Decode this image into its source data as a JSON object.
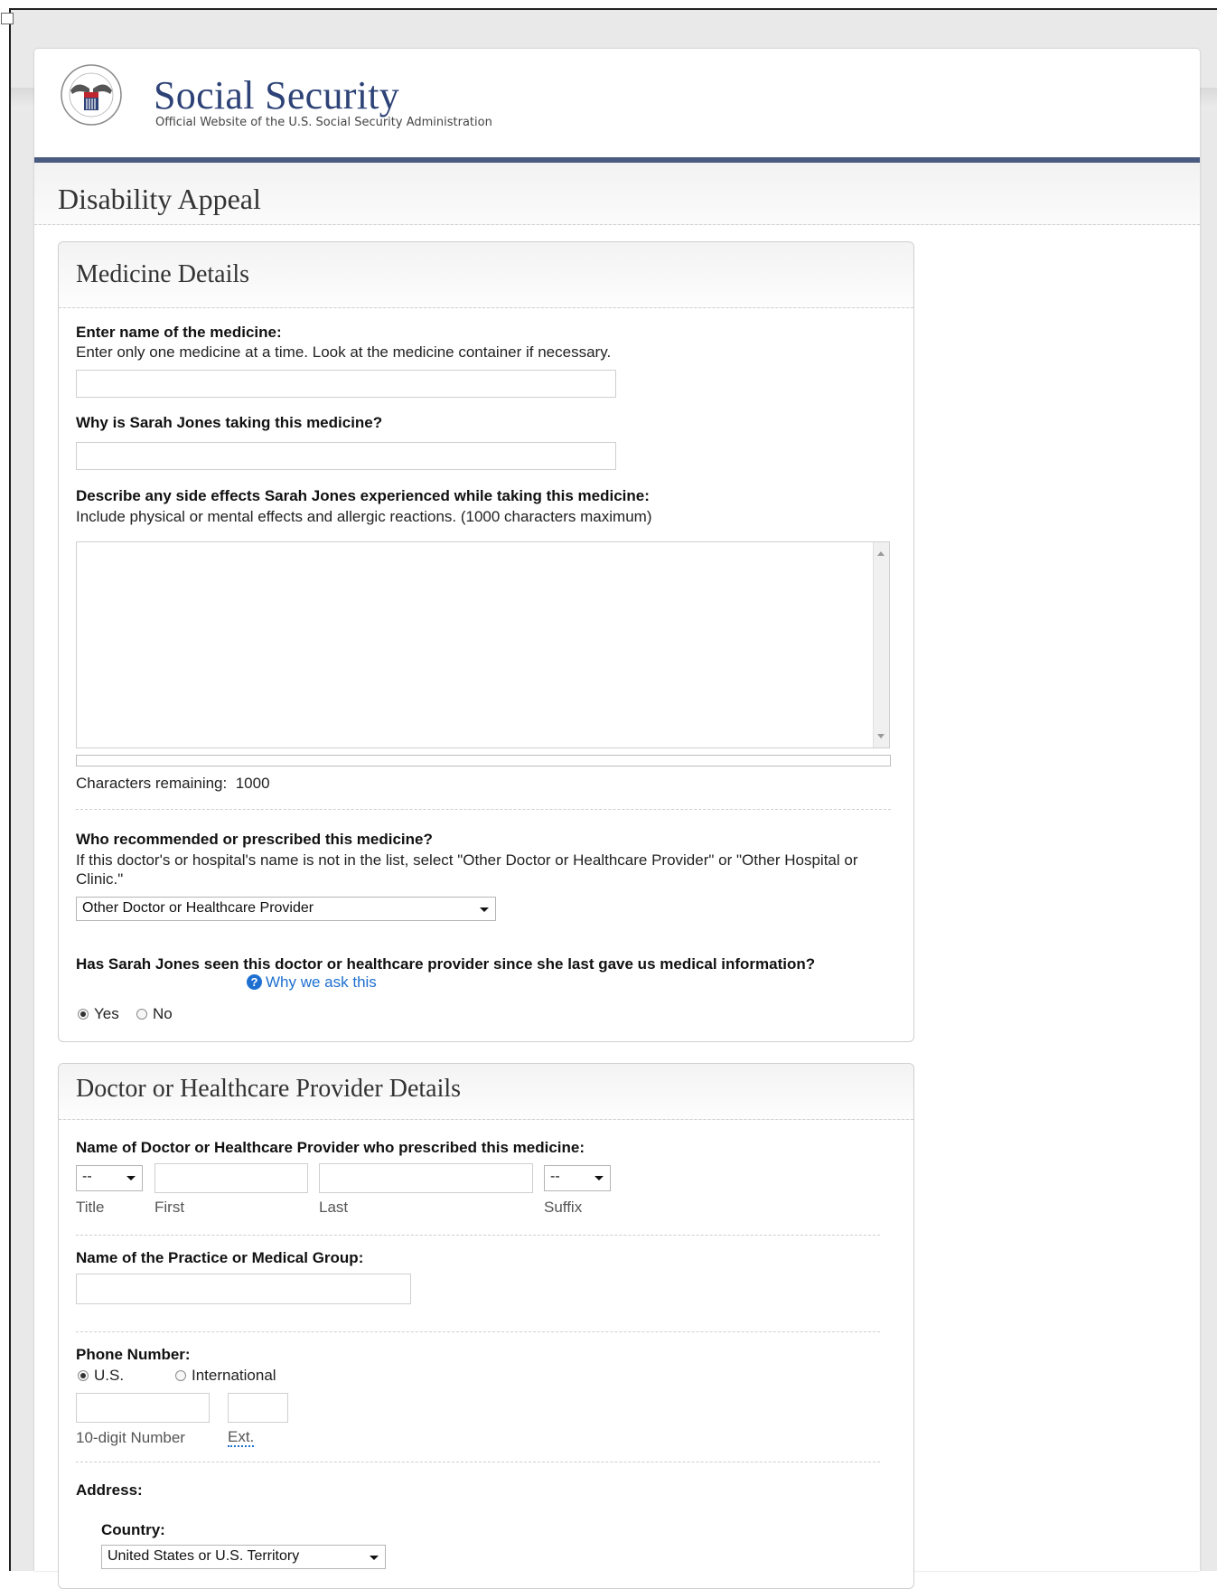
{
  "site": {
    "title": "Social Security",
    "subtitle": "Official Website of the U.S. Social Security Administration",
    "seal_text": "SOCIAL SECURITY ADMINISTRATION USA"
  },
  "page_title": "Disability Appeal",
  "medicine": {
    "heading": "Medicine Details",
    "name_label": "Enter name of the medicine:",
    "name_hint": "Enter only one medicine at a time. Look at the medicine container if necessary.",
    "name_value": "",
    "why_label": "Why is Sarah Jones taking this medicine?",
    "why_value": "",
    "side_label": "Describe any side effects Sarah Jones experienced while taking this medicine:",
    "side_hint": "Include physical or mental effects and allergic reactions. (1000 characters maximum)",
    "side_value": "",
    "chars_remaining_label": "Characters remaining:",
    "chars_remaining": "1000",
    "chars_used_fraction": 0,
    "prescriber_label": "Who recommended or prescribed this medicine?",
    "prescriber_hint": "If this doctor's or hospital's name is not in the list, select \"Other Doctor or Healthcare Provider\" or \"Other Hospital or Clinic.\"",
    "prescriber_value": "Other Doctor or Healthcare Provider",
    "seen_label": "Has Sarah Jones seen this doctor or healthcare provider since she last gave us medical information?",
    "why_ask": "Why we ask this",
    "yes": "Yes",
    "no": "No",
    "selected": "Yes"
  },
  "doctor": {
    "heading": "Doctor or Healthcare Provider Details",
    "name_label": "Name of Doctor or Healthcare Provider who prescribed this medicine:",
    "title_value": "--",
    "suffix_value": "--",
    "title_caption": "Title",
    "first_caption": "First",
    "last_caption": "Last",
    "suffix_caption": "Suffix",
    "practice_label": "Name of the Practice or Medical Group:",
    "phone_label": "Phone Number:",
    "us": "U.S.",
    "international": "International",
    "phone_selected": "U.S.",
    "number_caption": "10-digit Number",
    "ext_caption": "Ext.",
    "address_label": "Address:",
    "country_label": "Country:",
    "country_value": "United States or U.S. Territory"
  },
  "colors": {
    "brand_blue": "#2d4276",
    "rule": "#4a5b80",
    "link": "#1e6fd0"
  }
}
